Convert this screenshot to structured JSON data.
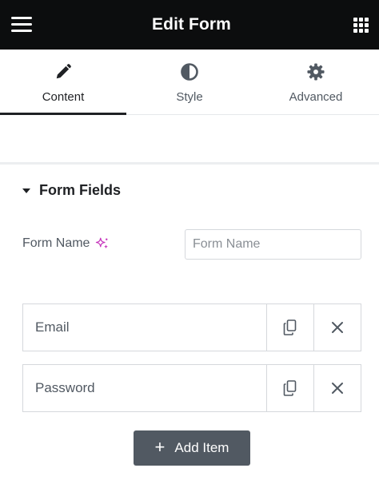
{
  "header": {
    "title": "Edit Form",
    "menu_icon": "hamburger-menu-icon",
    "apps_icon": "grid-apps-icon"
  },
  "tabs": [
    {
      "label": "Content",
      "icon": "pencil-icon",
      "active": true
    },
    {
      "label": "Style",
      "icon": "half-circle-contrast-icon",
      "active": false
    },
    {
      "label": "Advanced",
      "icon": "gear-icon",
      "active": false
    }
  ],
  "section": {
    "title": "Form Fields",
    "expanded": true
  },
  "form_name": {
    "label": "Form Name",
    "value": "",
    "placeholder": "Form Name",
    "ai_icon": "ai-sparkle-icon"
  },
  "items": [
    {
      "title": "Email"
    },
    {
      "title": "Password"
    }
  ],
  "add_button": {
    "label": "Add Item"
  },
  "colors": {
    "header_bg": "#0c0d0e",
    "button_bg": "#515962",
    "ai_accent": "#c738bd",
    "border": "#d5d8dc"
  }
}
